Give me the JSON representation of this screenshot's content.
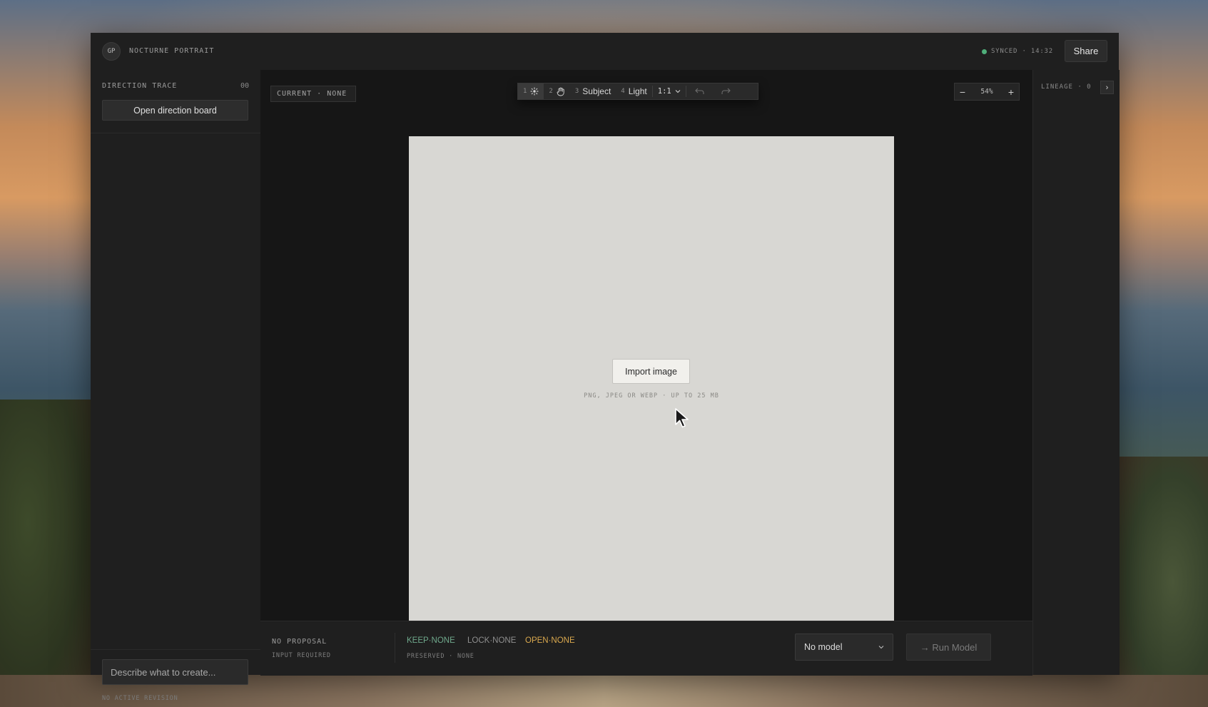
{
  "header": {
    "avatar_initials": "GP",
    "project_title": "NOCTURNE PORTRAIT",
    "sync_status": "SYNCED · 14:32",
    "share_label": "Share"
  },
  "left_panel": {
    "trace_label": "DIRECTION TRACE",
    "trace_count": "00",
    "open_board_label": "Open direction board",
    "prompt_placeholder": "Describe what to create...",
    "revision_status": "NO ACTIVE REVISION"
  },
  "canvas": {
    "current_badge": "CURRENT · NONE",
    "toolbar": {
      "tools": [
        {
          "num": "1",
          "icon": "magic-select-icon"
        },
        {
          "num": "2",
          "icon": "hand-icon"
        },
        {
          "num": "3",
          "label": "Subject"
        },
        {
          "num": "4",
          "label": "Light"
        }
      ],
      "ratio": "1:1",
      "undo_icon": "undo-icon",
      "redo_icon": "redo-icon"
    },
    "zoom": {
      "minus": "−",
      "value": "54%",
      "plus": "+"
    },
    "import_label": "Import image",
    "import_hint": "PNG, JPEG OR WEBP · UP TO 25 MB"
  },
  "bottom_bar": {
    "proposal": "NO PROPOSAL",
    "input_required": "INPUT REQUIRED",
    "keep": "KEEP·NONE",
    "lock": "LOCK·NONE",
    "open": "OPEN·NONE",
    "preserved": "PRESERVED · NONE",
    "model": "No model",
    "run_label": "→ Run Model"
  },
  "right_panel": {
    "lineage": "LINEAGE · 0",
    "expand": "›"
  },
  "colors": {
    "sync_dot": "#4fae7a",
    "keep": "#6fa88b",
    "open": "#d9a84e"
  }
}
